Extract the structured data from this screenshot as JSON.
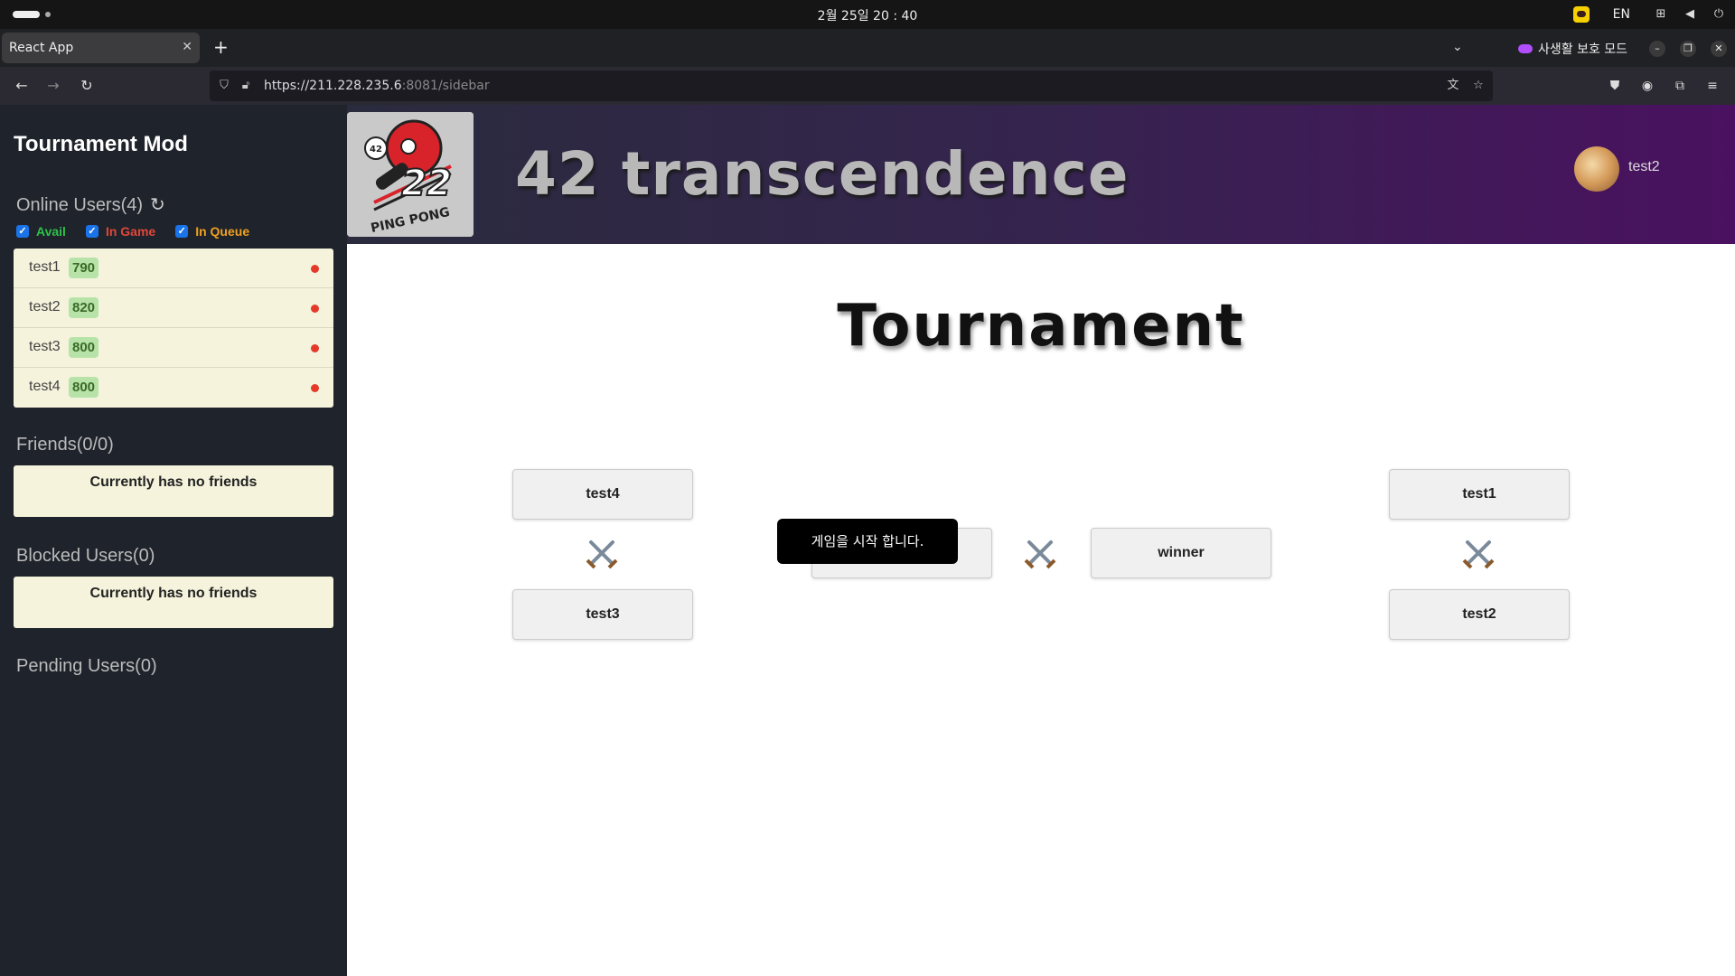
{
  "os": {
    "clock": "2월 25일  20 : 40",
    "lang": "EN"
  },
  "browser": {
    "tab_title": "React App",
    "tab_close": "✕",
    "new_tab": "+",
    "privacy_label": "사생활 보호 모드",
    "url_host": "https://211.228.235.6",
    "url_rest": ":8081/sidebar"
  },
  "sidebar": {
    "title": "Tournament Mod",
    "online_label": "Online Users(4)",
    "filters": [
      {
        "label": "Avail",
        "checked": true,
        "color": "#2ec04a"
      },
      {
        "label": "In Game",
        "checked": true,
        "color": "#e0473a"
      },
      {
        "label": "In Queue",
        "checked": true,
        "color": "#f0a020"
      }
    ],
    "users": [
      {
        "name": "test1",
        "score": "790",
        "status_color": "#e53a2a"
      },
      {
        "name": "test2",
        "score": "820",
        "status_color": "#e53a2a"
      },
      {
        "name": "test3",
        "score": "800",
        "status_color": "#e53a2a"
      },
      {
        "name": "test4",
        "score": "800",
        "status_color": "#e53a2a"
      }
    ],
    "friends_label": "Friends(0/0)",
    "friends_empty": "Currently has no friends",
    "blocked_label": "Blocked Users(0)",
    "blocked_empty": "Currently has no friends",
    "pending_label": "Pending Users(0)"
  },
  "header": {
    "logo_number": "22",
    "logo_ball_text": "42",
    "logo_caption": "PING PONG",
    "title": "42 transcendence",
    "username": "test2"
  },
  "tournament": {
    "title": "Tournament",
    "left_top": "test4",
    "left_bottom": "test3",
    "right_top": "test1",
    "right_bottom": "test2",
    "final_right": "winner",
    "toast": "게임을 시작 합니다."
  },
  "colors": {
    "sidebar_bg": "#1f232b",
    "card_bg": "#f5f3dc",
    "score_bg": "#b7e3a8",
    "status_dot": "#e53a2a"
  }
}
